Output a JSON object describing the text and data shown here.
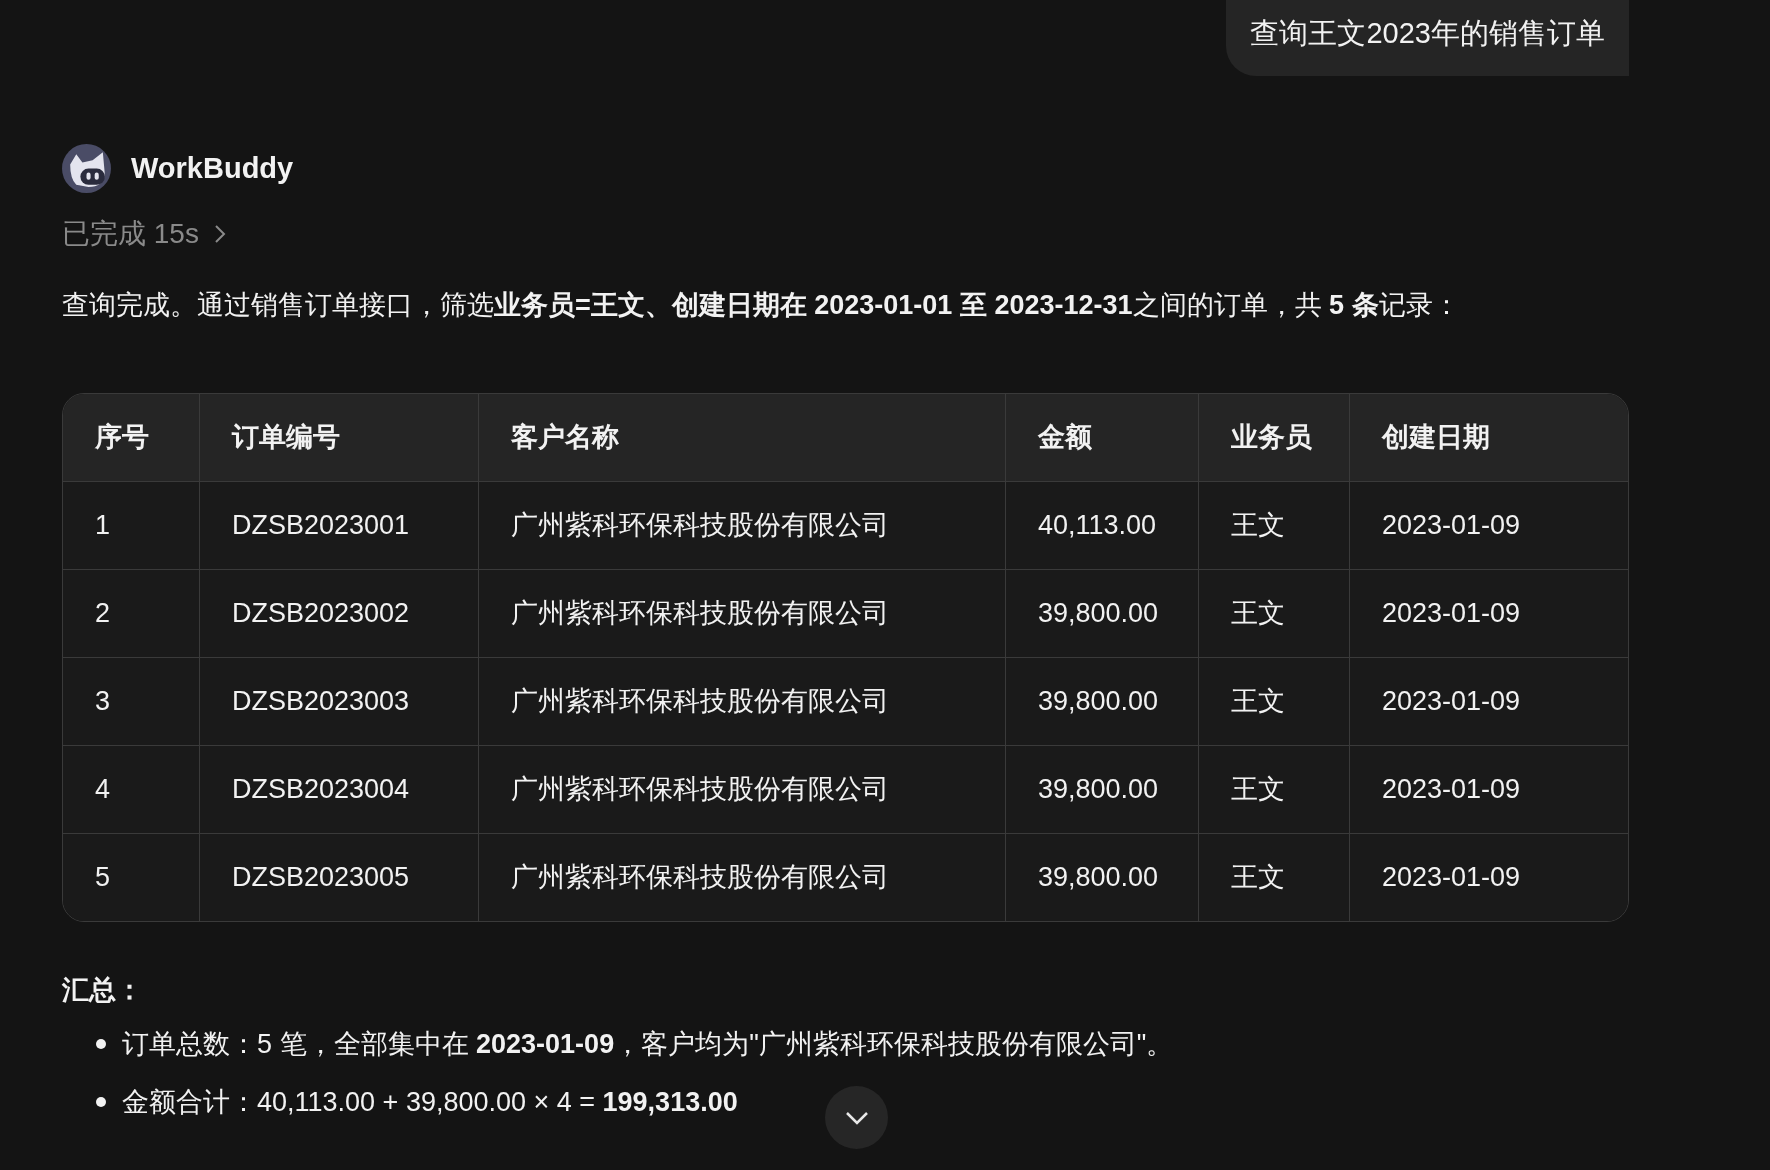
{
  "user_message": "查询王文2023年的销售订单",
  "assistant": {
    "name": "WorkBuddy",
    "status": "已完成 15s"
  },
  "intro": "查询完成。通过销售订单接口，筛选**业务员=王文、创建日期在 2023-01-01 至 2023-12-31**之间的订单，共 **5 条**记录：",
  "table": {
    "columns": [
      "序号",
      "订单编号",
      "客户名称",
      "金额",
      "业务员",
      "创建日期"
    ],
    "rows": [
      [
        "1",
        "DZSB2023001",
        "广州紫科环保科技股份有限公司",
        "40,113.00",
        "王文",
        "2023-01-09"
      ],
      [
        "2",
        "DZSB2023002",
        "广州紫科环保科技股份有限公司",
        "39,800.00",
        "王文",
        "2023-01-09"
      ],
      [
        "3",
        "DZSB2023003",
        "广州紫科环保科技股份有限公司",
        "39,800.00",
        "王文",
        "2023-01-09"
      ],
      [
        "4",
        "DZSB2023004",
        "广州紫科环保科技股份有限公司",
        "39,800.00",
        "王文",
        "2023-01-09"
      ],
      [
        "5",
        "DZSB2023005",
        "广州紫科环保科技股份有限公司",
        "39,800.00",
        "王文",
        "2023-01-09"
      ]
    ]
  },
  "summary": {
    "heading": "汇总：",
    "bullets": [
      "订单总数：5 笔，全部集中在 **2023-01-09**，客户均为\"广州紫科环保科技股份有限公司\"。",
      "金额合计：40,113.00 + 39,800.00 × 4 = **199,313.00**"
    ]
  }
}
